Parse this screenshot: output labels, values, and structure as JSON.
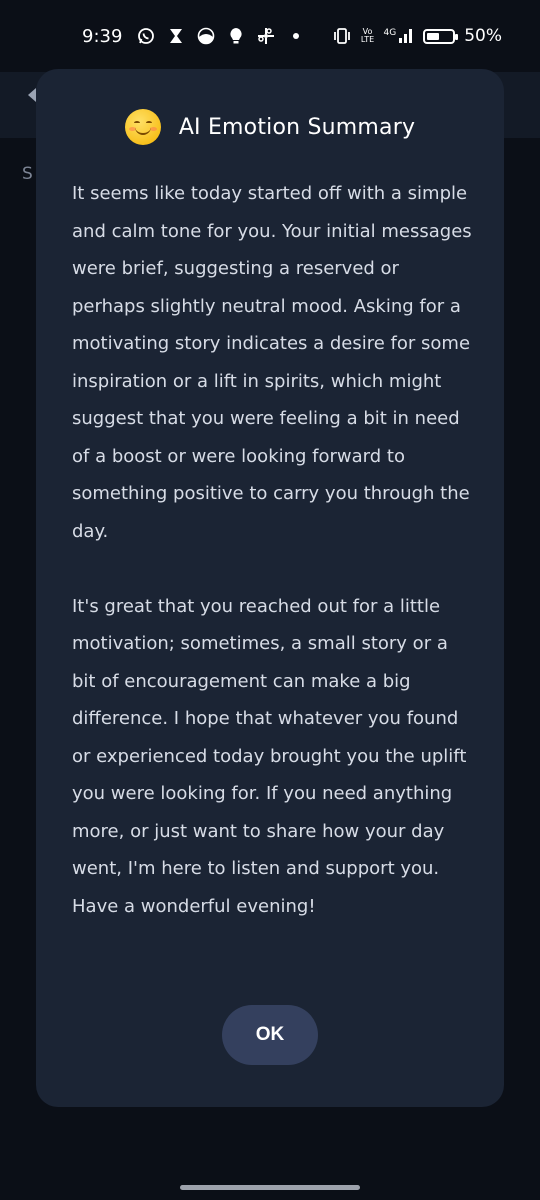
{
  "status_bar": {
    "time": "9:39",
    "left_icons": [
      "whatsapp-icon",
      "hourglass-icon",
      "half-moon-icon",
      "lightbulb-icon",
      "pinwheel-icon",
      "dot-icon"
    ],
    "network_label_1": "Vo LTE",
    "network_label_2": "4G",
    "battery_percent": "50%",
    "battery_level": 0.5
  },
  "background_app": {
    "partial_letter": "S"
  },
  "dialog": {
    "emoji": "😊",
    "title": "AI Emotion Summary",
    "paragraphs": [
      "It seems like today started off with a simple and calm tone for you. Your initial messages were brief, suggesting a reserved or perhaps slightly neutral mood. Asking for a motivating story indicates a desire for some inspiration or a lift in spirits, which might suggest that you were feeling a bit in need of a boost or were looking forward to something positive to carry you through the day.",
      "It's great that you reached out for a little motivation; sometimes, a small story or a bit of encouragement can make a big difference. I hope that whatever you found or experienced today brought you the uplift you were looking for. If you need anything more, or just want to share how your day went, I'm here to listen and support you. Have a wonderful evening!"
    ],
    "ok_label": "OK"
  },
  "colors": {
    "dialog_background": "#1b2434",
    "screen_background": "#0b0f17",
    "button_background": "#34405e"
  }
}
